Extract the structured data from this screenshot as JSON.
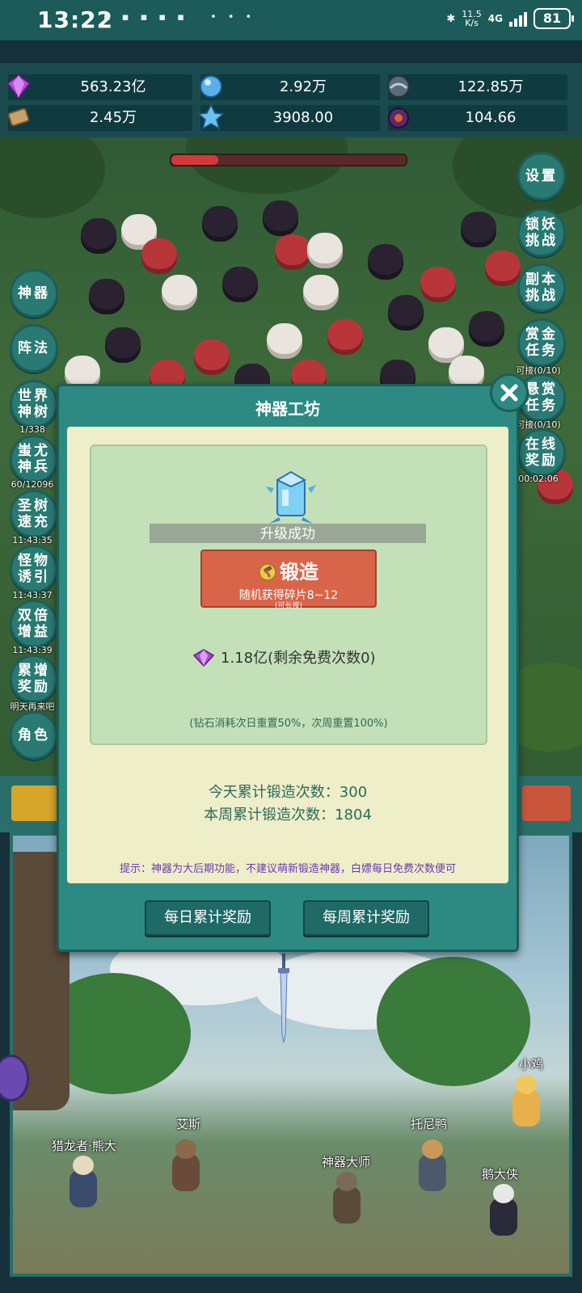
{
  "status_bar": {
    "time": "13:22",
    "net_speed": "11.5",
    "net_unit": "K/s",
    "network": "4G",
    "battery": "81"
  },
  "resources": [
    {
      "icon": "purple-diamond-icon",
      "value": "563.23亿"
    },
    {
      "icon": "blue-orb-icon",
      "value": "2.92万"
    },
    {
      "icon": "steel-orb-icon",
      "value": "122.85万"
    },
    {
      "icon": "scroll-icon",
      "value": "2.45万"
    },
    {
      "icon": "ice-crystal-icon",
      "value": "3908.00"
    },
    {
      "icon": "dark-orb-icon",
      "value": "104.66"
    }
  ],
  "battle": {
    "enemy_hp_fraction": 0.2
  },
  "left_menu": [
    {
      "label": "神器",
      "caption": ""
    },
    {
      "label": "阵法",
      "caption": ""
    },
    {
      "label": "世界神树",
      "caption": "1/338"
    },
    {
      "label": "蚩尤神兵",
      "caption": "60/12096"
    },
    {
      "label": "圣树速充",
      "caption": "11:43:35"
    },
    {
      "label": "怪物诱引",
      "caption": "11:43:37"
    },
    {
      "label": "双倍增益",
      "caption": "11:43:39"
    },
    {
      "label": "累增奖励",
      "caption": "明天再来吧"
    },
    {
      "label": "角色",
      "caption": ""
    }
  ],
  "right_menu": [
    {
      "label": "设置",
      "caption": ""
    },
    {
      "label": "锁妖挑战",
      "caption": ""
    },
    {
      "label": "副本挑战",
      "caption": ""
    },
    {
      "label": "赏金任务",
      "caption": "可接(0/10)"
    },
    {
      "label": "悬赏任务",
      "caption": "可接(0/10)"
    },
    {
      "label": "在线奖励",
      "caption": "00:02:06"
    }
  ],
  "dialog": {
    "title": "神器工坊",
    "banner": "升级成功",
    "forge_button": {
      "label": "锻造",
      "sub": "随机获得碎片8~12",
      "hint": "(可长按)"
    },
    "cost": "1.18亿(剩余免费次数0)",
    "cost_note": "(钻石消耗次日重置50%，次周重置100%)",
    "today_count": "今天累计锻造次数：300",
    "week_count": "本周累计锻造次数：1804",
    "tip": "提示：神器为大后期功能，不建议萌新锻造神器，白嫖每日免费次数便可",
    "daily_reward_button": "每日累计奖励",
    "weekly_reward_button": "每周累计奖励"
  },
  "npcs": [
    "猎龙者·熊大",
    "艾斯",
    "神器大师",
    "托尼鸭",
    "鹅大侠",
    "小鸡"
  ],
  "colors": {
    "panel": "#2d8a82",
    "inner": "#eeeec9",
    "forge_panel": "#c3e0b9",
    "forge_button": "#d8654a",
    "tip": "#6a3ab0"
  }
}
